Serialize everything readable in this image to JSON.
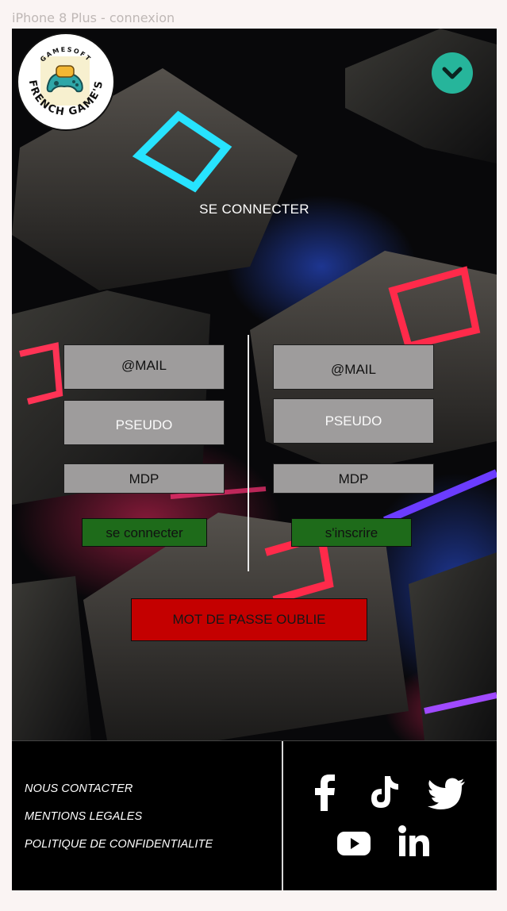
{
  "frame_label": "iPhone 8 Plus - connexion",
  "logo": {
    "top_text": "GAMESOFT",
    "bottom_text": "FRENCH GAME'S"
  },
  "menu_toggle": {
    "icon": "chevron-down-icon",
    "color": "#26b59b"
  },
  "title": "SE CONNECTER",
  "login_form": {
    "email": "@MAIL",
    "pseudo": "PSEUDO",
    "password": "MDP",
    "submit": "se connecter"
  },
  "register_form": {
    "email": "@MAIL",
    "pseudo": "PSEUDO",
    "password": "MDP",
    "submit": "s'inscrire"
  },
  "forgot_password": "MOT DE PASSE OUBLIE",
  "footer": {
    "links": [
      "NOUS CONTACTER",
      "MENTIONS LEGALES",
      "POLITIQUE DE CONFIDENTIALITE"
    ],
    "social": [
      "facebook-icon",
      "tiktok-icon",
      "twitter-icon",
      "youtube-icon",
      "linkedin-icon"
    ]
  },
  "colors": {
    "accent": "#26b59b",
    "field": "#9e9c9c",
    "primary_button": "#1e6b1a",
    "danger_button": "#c40000"
  }
}
